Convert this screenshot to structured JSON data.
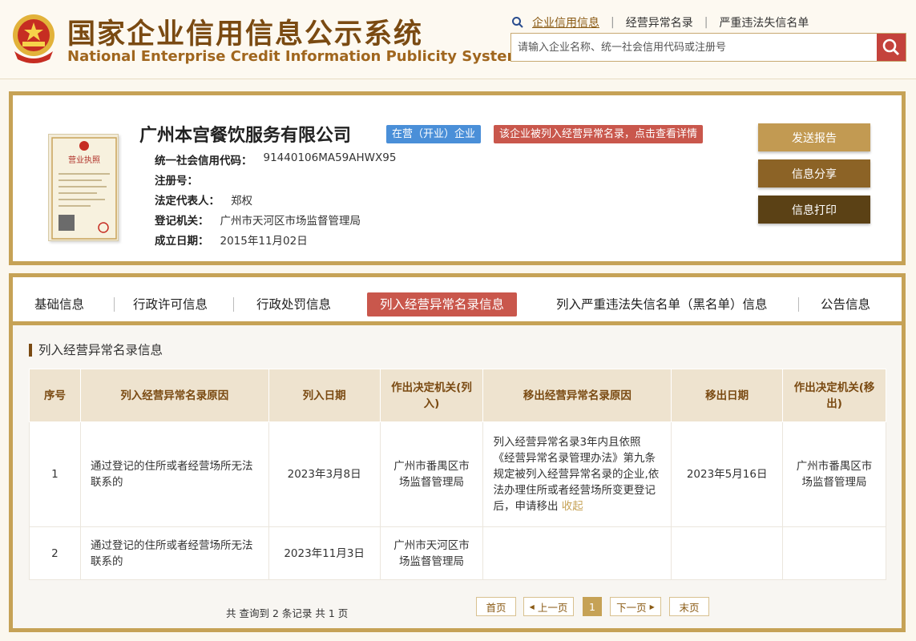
{
  "header": {
    "title_cn": "国家企业信用信息公示系统",
    "title_en": "National Enterprise Credit Information Publicity System",
    "nav": [
      "企业信用信息",
      "经营异常名录",
      "严重违法失信名单"
    ],
    "search_placeholder": "请输入企业名称、统一社会信用代码或注册号"
  },
  "company": {
    "name": "广州本宫餐饮服务有限公司",
    "status_badge": "在营（开业）企业",
    "abnormal_badge": "该企业被列入经营异常名录，点击查看详情",
    "license_label": "营业执照",
    "fields": [
      {
        "key": "统一社会信用代码：",
        "value": "91440106MA59AHWX95"
      },
      {
        "key": "注册号：",
        "value": ""
      },
      {
        "key": "法定代表人：",
        "value": "郑权"
      },
      {
        "key": "登记机关：",
        "value": "广州市天河区市场监督管理局"
      },
      {
        "key": "成立日期：",
        "value": "2015年11月02日"
      }
    ],
    "actions": [
      "发送报告",
      "信息分享",
      "信息打印"
    ]
  },
  "tabs": [
    "基础信息",
    "行政许可信息",
    "行政处罚信息",
    "列入经营异常名录信息",
    "列入严重违法失信名单（黑名单）信息",
    "公告信息"
  ],
  "section": {
    "title": "列入经营异常名录信息",
    "columns": [
      "序号",
      "列入经营异常名录原因",
      "列入日期",
      "作出决定机关(列入)",
      "移出经营异常名录原因",
      "移出日期",
      "作出决定机关(移出)"
    ],
    "rows": [
      {
        "no": "1",
        "reason_in": "通过登记的住所或者经营场所无法联系的",
        "date_in": "2023年3月8日",
        "org_in": "广州市番禺区市场监督管理局",
        "reason_out": "列入经营异常名录3年内且依照《经营异常名录管理办法》第九条规定被列入经营异常名录的企业,依法办理住所或者经营场所变更登记后，申请移出",
        "collapse": "收起",
        "date_out": "2023年5月16日",
        "org_out": "广州市番禺区市场监督管理局"
      },
      {
        "no": "2",
        "reason_in": "通过登记的住所或者经营场所无法联系的",
        "date_in": "2023年11月3日",
        "org_in": "广州市天河区市场监督管理局",
        "reason_out": "",
        "collapse": "",
        "date_out": "",
        "org_out": ""
      }
    ],
    "pager_info": "共 查询到 2 条记录 共 1 页",
    "pager": {
      "first": "首页",
      "prev": "上一页",
      "current": "1",
      "next": "下一页",
      "last": "末页"
    }
  },
  "colors": {
    "gold": "#c6a256",
    "brown": "#7a4a12",
    "red": "#c9574c",
    "blue": "#4a8fd8"
  }
}
